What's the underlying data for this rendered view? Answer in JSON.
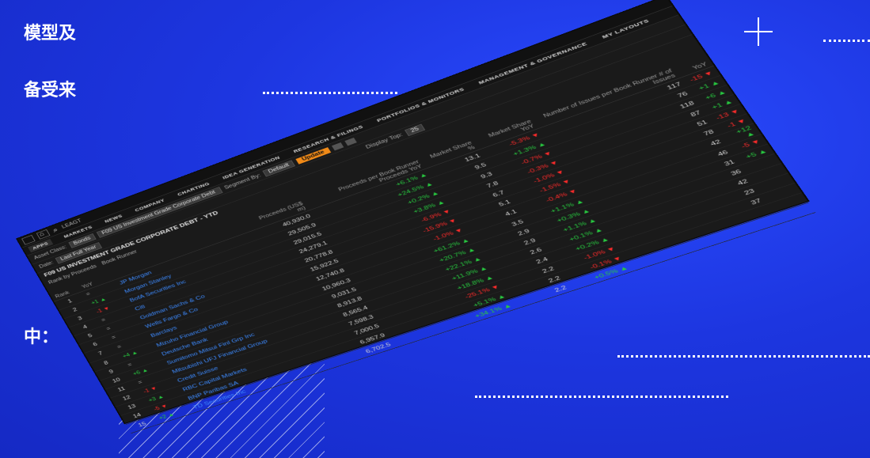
{
  "page": {
    "text_line1": "模型及",
    "text_line2": "备受来",
    "text_line3": "中："
  },
  "terminal": {
    "search_label": "LEAGT",
    "nav": [
      "APPS",
      "MARKETS",
      "NEWS",
      "COMPANY",
      "CHARTING",
      "IDEA GENERATION",
      "RESEARCH & FILINGS",
      "PORTFOLIOS & MONITORS",
      "MANAGEMENT & GOVERNANCE",
      "MY LAYOUTS"
    ],
    "controls": {
      "asset_class_label": "Asset Class:",
      "asset_class_value": "Bonds",
      "table_value": "F09 US Investment Grade Corporate Debt",
      "segment_label": "Segment By:",
      "segment_value": "Default",
      "update_label": "Update",
      "date_label": "Date:",
      "date_value": "Last Full Year",
      "display_label": "Display Top:",
      "display_value": "25"
    },
    "title": "F09 US INVESTMENT GRADE CORPORATE DEBT - YTD",
    "rank_by_label": "Rank by Proceeds",
    "book_runner_label": "Book Runner",
    "headers": {
      "rank": "Rank",
      "yoy": "YoY",
      "name": "",
      "proceeds": "Proceeds (US$ m)",
      "proceeds_yoy": "Proceeds per Book Runner\nProceeds YoY",
      "market_share": "Market Share %",
      "market_share_yoy": "Market Share YoY",
      "issues": "Number of Issues per Book Runner\n# of Issues",
      "issues_yoy": "YoY"
    },
    "rows": [
      {
        "rank": "1",
        "delta": "=",
        "name": "JP Morgan",
        "proceeds": "40,930.0",
        "p_yoy": "+6.1%",
        "share": "13.1",
        "s_yoy": "-5.3%",
        "issues": "117",
        "i_yoy": "-15"
      },
      {
        "rank": "2",
        "delta": "+1",
        "name": "Morgan Stanley",
        "proceeds": "29,505.9",
        "p_yoy": "+24.5%",
        "share": "9.5",
        "s_yoy": "+1.3%",
        "issues": "76",
        "i_yoy": "+1"
      },
      {
        "rank": "3",
        "delta": "-1",
        "name": "BofA Securities Inc",
        "proceeds": "29,015.5",
        "p_yoy": "+0.2%",
        "share": "9.3",
        "s_yoy": "-0.7%",
        "issues": "118",
        "i_yoy": "+6"
      },
      {
        "rank": "4",
        "delta": "=",
        "name": "Citi",
        "proceeds": "24,279.1",
        "p_yoy": "+3.8%",
        "share": "7.8",
        "s_yoy": "-0.3%",
        "issues": "87",
        "i_yoy": "+1"
      },
      {
        "rank": "5",
        "delta": "=",
        "name": "Goldman Sachs & Co",
        "proceeds": "20,778.8",
        "p_yoy": "-6.9%",
        "share": "6.7",
        "s_yoy": "-1.0%",
        "issues": "51",
        "i_yoy": "-13"
      },
      {
        "rank": "6",
        "delta": "=",
        "name": "Wells Fargo & Co",
        "proceeds": "15,922.5",
        "p_yoy": "-15.9%",
        "share": "5.1",
        "s_yoy": "-1.5%",
        "issues": "78",
        "i_yoy": "-1"
      },
      {
        "rank": "7",
        "delta": "=",
        "name": "Barclays",
        "proceeds": "12,740.8",
        "p_yoy": "-1.0%",
        "share": "4.1",
        "s_yoy": "-0.4%",
        "issues": "42",
        "i_yoy": "+12"
      },
      {
        "rank": "8",
        "delta": "+4",
        "name": "Mizuho Financial Group",
        "proceeds": "10,960.3",
        "p_yoy": "+61.2%",
        "share": "3.5",
        "s_yoy": "+1.1%",
        "issues": "46",
        "i_yoy": "-5"
      },
      {
        "rank": "9",
        "delta": "=",
        "name": "Deutsche Bank",
        "proceeds": "9,031.5",
        "p_yoy": "+20.7%",
        "share": "2.9",
        "s_yoy": "+0.3%",
        "issues": "31",
        "i_yoy": "+5"
      },
      {
        "rank": "10",
        "delta": "+6",
        "name": "Sumitomo Mitsui Finl Grp Inc",
        "proceeds": "8,913.8",
        "p_yoy": "+22.1%",
        "share": "2.9",
        "s_yoy": "+1.1%",
        "issues": "36",
        "i_yoy": ""
      },
      {
        "rank": "11",
        "delta": "=",
        "name": "Mitsubishi UFJ Financial Group",
        "proceeds": "8,565.4",
        "p_yoy": "+11.9%",
        "share": "2.6",
        "s_yoy": "+0.1%",
        "issues": "42",
        "i_yoy": ""
      },
      {
        "rank": "12",
        "delta": "-1",
        "name": "Credit Suisse",
        "proceeds": "7,598.3",
        "p_yoy": "+18.8%",
        "share": "2.4",
        "s_yoy": "+0.2%",
        "issues": "23",
        "i_yoy": ""
      },
      {
        "rank": "13",
        "delta": "+3",
        "name": "RBC Capital Markets",
        "proceeds": "7,000.5",
        "p_yoy": "-25.1%",
        "share": "2.2",
        "s_yoy": "-1.0%",
        "issues": "37",
        "i_yoy": ""
      },
      {
        "rank": "14",
        "delta": "-5",
        "name": "BNP Paribas SA",
        "proceeds": "6,957.9",
        "p_yoy": "+5.1%",
        "share": "2.2",
        "s_yoy": "-0.1%",
        "issues": "",
        "i_yoy": ""
      },
      {
        "rank": "15",
        "delta": "+2",
        "name": "TD Securities Inc",
        "proceeds": "6,702.5",
        "p_yoy": "+34.1%",
        "share": "2.2",
        "s_yoy": "+0.5%",
        "issues": "",
        "i_yoy": ""
      }
    ]
  },
  "colors": {
    "background": "#1f3ae6",
    "up": "#28c840",
    "down": "#ff2b2b",
    "link": "#3e8bff",
    "update": "#f08a18"
  }
}
